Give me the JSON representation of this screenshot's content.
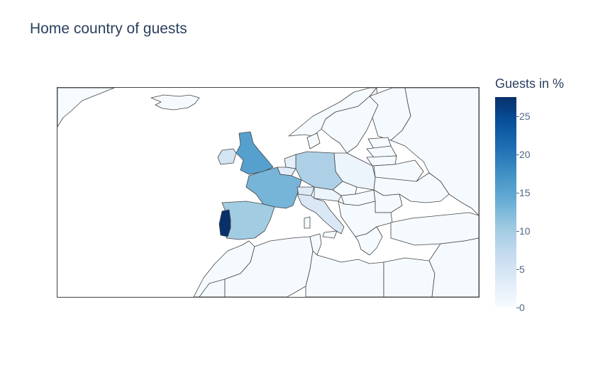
{
  "chart_data": {
    "type": "choropleth",
    "title": "Home country of guests",
    "colorbar": {
      "title": "Guests in %",
      "ticks": [
        "0",
        "5",
        "10",
        "15",
        "20",
        "25"
      ],
      "range": [
        0,
        27.5
      ],
      "colorscale": "Blues"
    },
    "regions": [
      {
        "name": "Portugal",
        "value": 27.4
      },
      {
        "name": "United Kingdom",
        "value": 15.5
      },
      {
        "name": "France",
        "value": 13.0
      },
      {
        "name": "Spain",
        "value": 10.0
      },
      {
        "name": "Germany",
        "value": 9.0
      },
      {
        "name": "Italy",
        "value": 4.0
      },
      {
        "name": "Ireland",
        "value": 5.0
      },
      {
        "name": "Switzerland",
        "value": 3.5
      },
      {
        "name": "Belgium",
        "value": 3.0
      },
      {
        "name": "Netherlands",
        "value": 2.5
      },
      {
        "name": "Poland",
        "value": 1.5
      },
      {
        "name": "Austria",
        "value": 1.5
      },
      {
        "name": "Morocco",
        "value": 0.3
      },
      {
        "name": "Algeria",
        "value": 0.2
      },
      {
        "name": "Greenland",
        "value": 0.1
      }
    ]
  }
}
